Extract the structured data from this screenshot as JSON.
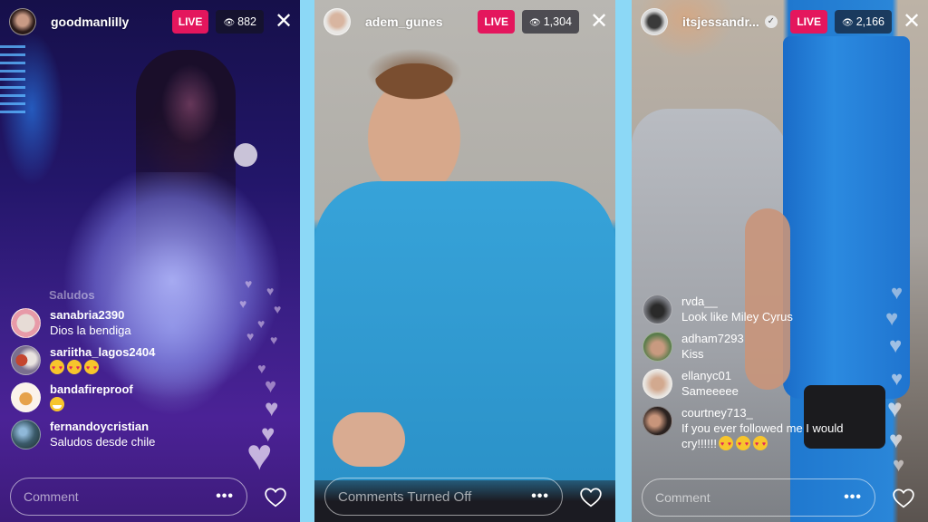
{
  "colors": {
    "live_badge": "#e4165d",
    "divider": "#8cd8f6"
  },
  "streams": [
    {
      "username": "goodmanlilly",
      "verified": false,
      "live_label": "LIVE",
      "viewer_icon": "eye-icon",
      "viewers": "882",
      "close_icon": "close-icon",
      "faded_comment": "Saludos",
      "comments": [
        {
          "user": "sanabria2390",
          "text": "Dios la bendiga",
          "emojis": []
        },
        {
          "user": "sariitha_lagos2404",
          "text": "",
          "emojis": [
            "heart-eyes",
            "heart-eyes",
            "heart-eyes"
          ]
        },
        {
          "user": "bandafireproof",
          "text": "",
          "emojis": [
            "grin"
          ]
        },
        {
          "user": "fernandoycristian",
          "text": "Saludos desde chile",
          "emojis": []
        }
      ],
      "comment_placeholder": "Comment",
      "more_label": "•••",
      "like_icon": "heart-outline-icon"
    },
    {
      "username": "adem_gunes",
      "verified": false,
      "live_label": "LIVE",
      "viewer_icon": "eye-icon",
      "viewers": "1,304",
      "close_icon": "close-icon",
      "comments": [],
      "comment_placeholder": "Comments Turned Off",
      "more_label": "•••",
      "like_icon": "heart-outline-icon"
    },
    {
      "username": "itsjessandr...",
      "verified": true,
      "live_label": "LIVE",
      "viewer_icon": "eye-icon",
      "viewers": "2,166",
      "close_icon": "close-icon",
      "comments": [
        {
          "user": "rvda__",
          "text": "Look like Miley Cyrus",
          "emojis": []
        },
        {
          "user": "adham7293",
          "text": "Kiss",
          "emojis": []
        },
        {
          "user": "ellanyc01",
          "text": "Sameeeee",
          "emojis": []
        },
        {
          "user": "courtney713_",
          "text": "If you ever followed me I would cry!!!!!!",
          "emojis": [
            "heart-eyes",
            "heart-eyes",
            "heart-eyes"
          ]
        }
      ],
      "comment_placeholder": "Comment",
      "more_label": "•••",
      "like_icon": "heart-outline-icon"
    }
  ]
}
